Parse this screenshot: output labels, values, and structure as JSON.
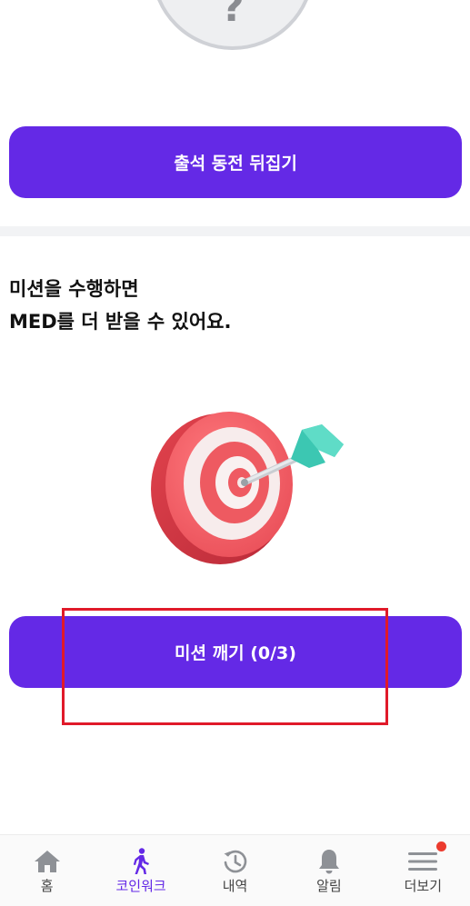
{
  "attendance": {
    "coin_symbol": "?",
    "flip_button_label": "출석 동전 뒤집기"
  },
  "mission": {
    "headline_line1": "미션을 수행하면",
    "headline_line2": "MED를 더 받을 수 있어요.",
    "button_label": "미션 깨기 (0/3)"
  },
  "colors": {
    "primary": "#6429e6",
    "highlight": "#e01a2a",
    "notification": "#ec3b2e"
  },
  "bottom_nav": {
    "items": [
      {
        "label": "홈",
        "icon": "home-icon",
        "active": false
      },
      {
        "label": "코인워크",
        "icon": "walking-person-icon",
        "active": true
      },
      {
        "label": "내역",
        "icon": "history-icon",
        "active": false
      },
      {
        "label": "알림",
        "icon": "bell-icon",
        "active": false
      },
      {
        "label": "더보기",
        "icon": "menu-icon",
        "active": false,
        "has_badge": true
      }
    ]
  }
}
